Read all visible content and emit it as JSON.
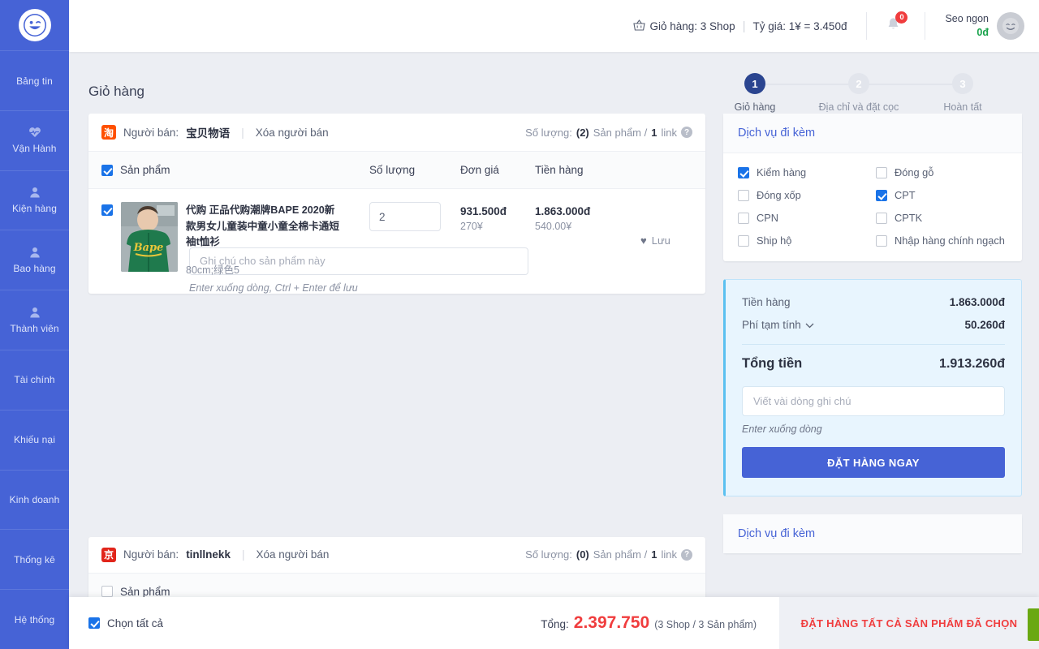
{
  "sidebar": {
    "logo_icon": "smiley-wink-icon",
    "items": [
      {
        "label": "Bảng tin",
        "icon": ""
      },
      {
        "label": "Vận Hành",
        "icon": "heartbeat-icon"
      },
      {
        "label": "Kiện hàng",
        "icon": "person-icon"
      },
      {
        "label": "Bao hàng",
        "icon": "person-icon"
      },
      {
        "label": "Thành viên",
        "icon": "person-icon"
      },
      {
        "label": "Tài chính",
        "icon": ""
      },
      {
        "label": "Khiếu nại",
        "icon": ""
      },
      {
        "label": "Kinh doanh",
        "icon": ""
      },
      {
        "label": "Thống kê",
        "icon": ""
      },
      {
        "label": "Hệ thống",
        "icon": ""
      }
    ]
  },
  "topbar": {
    "basket_icon": "basket-icon",
    "cart_text": "Giỏ hàng: 3 Shop",
    "rate_text": "Tỷ giá: 1¥ = 3.450đ",
    "bell_icon": "bell-icon",
    "notification_count": "0",
    "user_name": "Seo ngon",
    "user_balance": "0đ",
    "avatar_icon": "smiley-avatar-icon"
  },
  "page": {
    "title": "Giỏ hàng"
  },
  "stepper": {
    "steps": [
      {
        "number": "1",
        "label": "Giỏ hàng",
        "active": true
      },
      {
        "number": "2",
        "label": "Địa chỉ và đặt cọc",
        "active": false
      },
      {
        "number": "3",
        "label": "Hoàn tất",
        "active": false
      }
    ]
  },
  "seller_card": {
    "shop_icon": "taobao-icon",
    "seller_label": "Người bán:",
    "seller_name": "宝贝物语",
    "separator": "|",
    "delete_seller": "Xóa người bán",
    "qty_label": "Số lượng:",
    "qty_count": "(2)",
    "qty_unit": "Sản phẩm /",
    "link_count": "1",
    "link_unit": "link",
    "help_icon": "question-circle-icon",
    "columns": {
      "product": "Sản phẩm",
      "quantity": "Số lượng",
      "unit_price": "Đơn giá",
      "amount": "Tiền hàng"
    },
    "product": {
      "title": "代购 正品代购潮牌BAPE 2020新款男女儿童装中童小童全棉卡通短袖t恤衫",
      "variant": "80cm;绿色5",
      "quantity": "2",
      "unit_price_vnd": "931.500đ",
      "unit_price_cny": "270¥",
      "amount_vnd": "1.863.000đ",
      "amount_cny": "540.00¥",
      "save_icon": "heart-icon",
      "save_label": "Lưu",
      "note_placeholder": "Ghi chú cho sản phẩm này",
      "note_hint": "Enter xuống dòng, Ctrl + Enter để lưu"
    }
  },
  "seller_card_2": {
    "shop_icon": "jd-icon",
    "seller_label": "Người bán:",
    "seller_name": "tinllnekk",
    "separator": "|",
    "delete_seller": "Xóa người bán",
    "qty_label": "Số lượng:",
    "qty_count": "(0)",
    "qty_unit": "Sản phẩm /",
    "link_count": "1",
    "link_unit": "link",
    "help_icon": "question-circle-icon"
  },
  "services": {
    "title": "Dịch vụ đi kèm",
    "items": [
      {
        "label": "Kiểm hàng",
        "checked": true
      },
      {
        "label": "Đóng gỗ",
        "checked": false
      },
      {
        "label": "Đóng xốp",
        "checked": false
      },
      {
        "label": "CPT",
        "checked": true
      },
      {
        "label": "CPN",
        "checked": false
      },
      {
        "label": "CPTK",
        "checked": false
      },
      {
        "label": "Ship hộ",
        "checked": false
      },
      {
        "label": "Nhập hàng chính ngạch",
        "checked": false
      }
    ]
  },
  "services_2": {
    "title": "Dịch vụ đi kèm"
  },
  "summary": {
    "goods_label": "Tiền hàng",
    "goods_value": "1.863.000đ",
    "fee_label": "Phí tạm tính",
    "fee_chevron_icon": "chevron-down-icon",
    "fee_value": "50.260đ",
    "total_label": "Tổng tiền",
    "total_value": "1.913.260đ",
    "note_placeholder": "Viết vài dòng ghi chú",
    "note_hint": "Enter xuống dòng",
    "order_button": "ĐẶT HÀNG NGAY"
  },
  "bottombar": {
    "select_all": "Chọn tất cả",
    "total_label": "Tổng:",
    "total_value": "2.397.750",
    "total_sub": "(3 Shop / 3 Sản phẩm)",
    "order_all_button": "ĐẶT HÀNG TẤT CẢ SẢN PHẨM ĐÃ CHỌN"
  },
  "colors": {
    "sidebar": "#4663d6",
    "accent": "#4663d6",
    "danger": "#f03d3e",
    "success": "#17a24a",
    "panel_bg": "#e8f5fe",
    "taobao": "#ff5000",
    "jd": "#e1251b",
    "green_tab": "#6aa812"
  }
}
